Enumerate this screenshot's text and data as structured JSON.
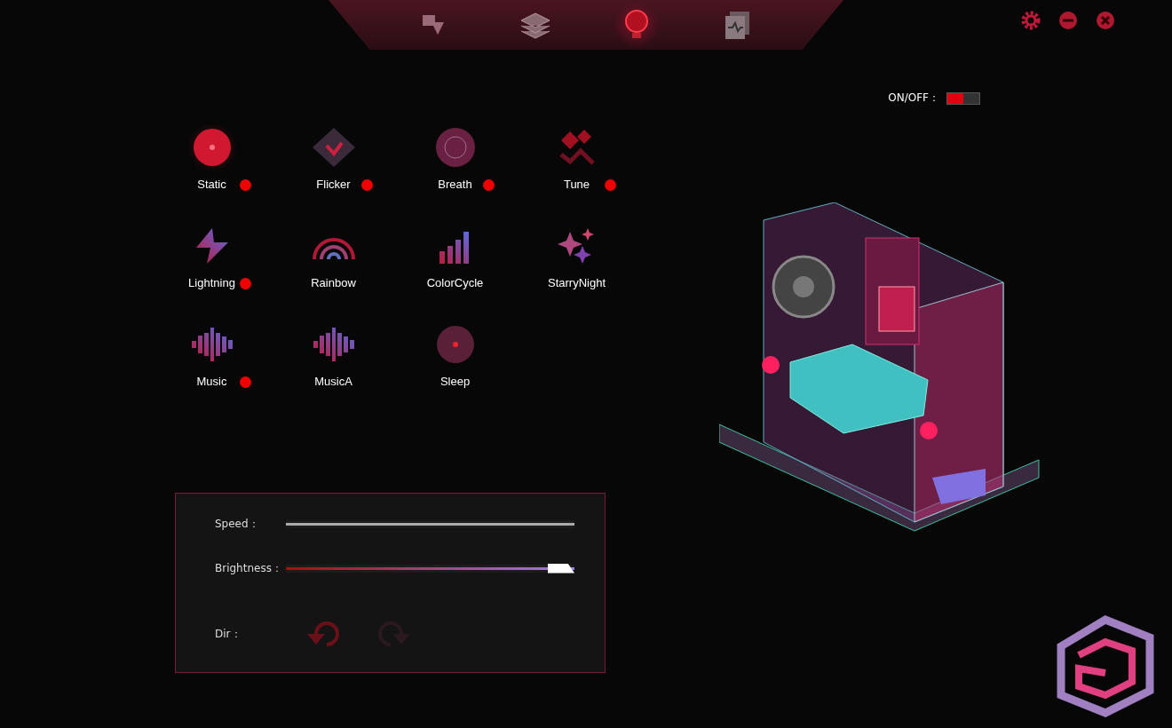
{
  "nav_tabs": [
    {
      "kind": "devices",
      "selected": false
    },
    {
      "kind": "layers",
      "selected": false
    },
    {
      "kind": "bulb",
      "selected": true
    },
    {
      "kind": "monitor",
      "selected": false
    }
  ],
  "power": {
    "label": "ON/OFF：",
    "on": true
  },
  "effects": [
    {
      "name": "Static",
      "kind": "static",
      "selected": true,
      "marked": true
    },
    {
      "name": "Flicker",
      "kind": "flicker",
      "selected": false,
      "marked": true
    },
    {
      "name": "Breath",
      "kind": "breath",
      "selected": false,
      "marked": true
    },
    {
      "name": "Tune",
      "kind": "tune",
      "selected": false,
      "marked": true
    },
    {
      "name": "Lightning",
      "kind": "lightning",
      "selected": false,
      "marked": true
    },
    {
      "name": "Rainbow",
      "kind": "rainbow",
      "selected": false,
      "marked": false
    },
    {
      "name": "ColorCycle",
      "kind": "bars",
      "selected": false,
      "marked": false
    },
    {
      "name": "StarryNight",
      "kind": "stars",
      "selected": false,
      "marked": false
    },
    {
      "name": "Music",
      "kind": "music",
      "selected": false,
      "marked": true
    },
    {
      "name": "MusicA",
      "kind": "music",
      "selected": false,
      "marked": false
    },
    {
      "name": "Sleep",
      "kind": "sleep",
      "selected": false,
      "marked": false
    }
  ],
  "settings": {
    "speed": {
      "label": "Speed：",
      "disabled": true,
      "level": 1
    },
    "brightness": {
      "label": "Brightness：",
      "disabled": false,
      "level": 1
    },
    "direction": {
      "label": "Dir：",
      "options": [
        {
          "kind": "ccw",
          "selected": true
        },
        {
          "kind": "cw",
          "selected": false
        }
      ]
    }
  }
}
